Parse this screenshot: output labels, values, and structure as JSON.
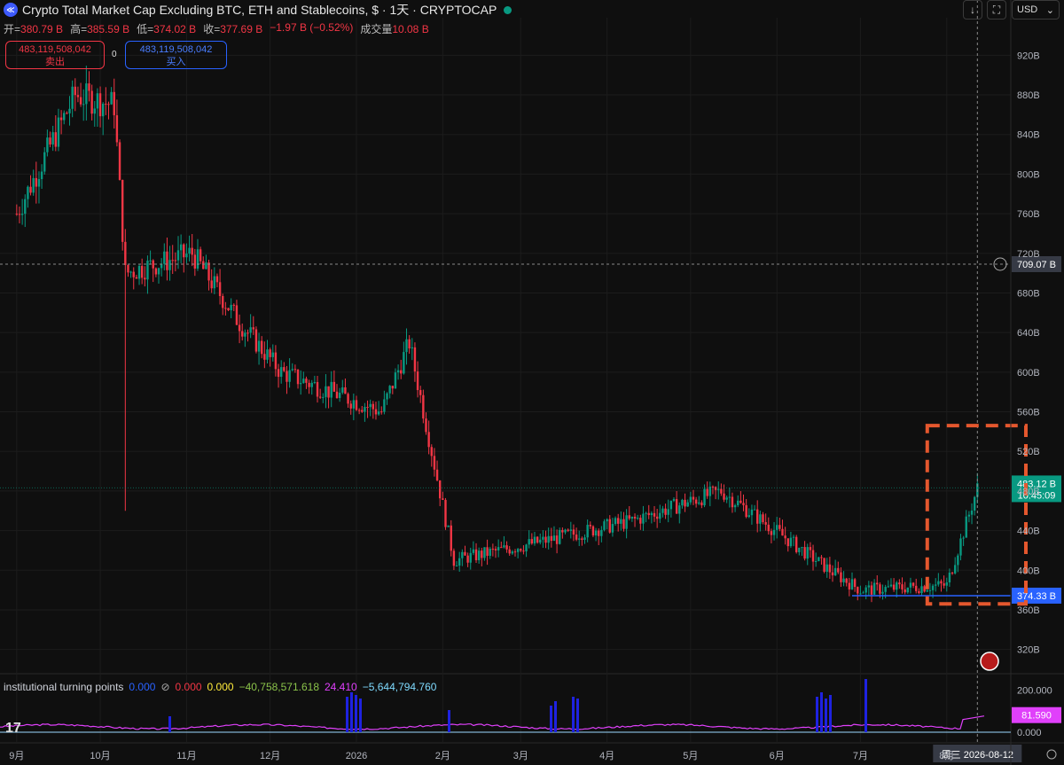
{
  "header": {
    "title": "Crypto Total Market Cap Excluding BTC, ETH and Stablecoins, $ · 1天 · CRYPTOCAP",
    "logo_glyph": "≪"
  },
  "ohlc": {
    "open_label": "开=",
    "open": "380.79 B",
    "high_label": "高=",
    "high": "385.59 B",
    "low_label": "低=",
    "low": "374.02 B",
    "close_label": "收=",
    "close": "377.69 B",
    "change": "−1.97 B (−0.52%)",
    "volume_label": "成交量",
    "volume": "10.08 B"
  },
  "trade": {
    "sell_price": "483,119,508,042",
    "sell_label": "卖出",
    "spread": "0",
    "buy_price": "483,119,508,042",
    "buy_label": "买入"
  },
  "toolbar": {
    "download_glyph": "↓",
    "fullscreen_glyph": "⛶",
    "currency": "USD",
    "currency_caret": "⌄"
  },
  "colors": {
    "up": "#089981",
    "down": "#f23645",
    "bg": "#0f0f0f",
    "grid": "#1c1c1c",
    "accent_blue": "#2962ff",
    "annotation": "#e4572e",
    "indicator_line": "#e040fb"
  },
  "indicator": {
    "name": "institutional turning points",
    "values": [
      "0.000",
      "0.000",
      "0.000",
      "−40,758,571.618",
      "24.410",
      "−5,644,794.760"
    ],
    "colors": [
      "#2962ff",
      "#f23645",
      "#ffeb3b",
      "#8bc34a",
      "#e040fb",
      "#7fdbff"
    ],
    "axis_ticks": [
      "200.000",
      "0.000"
    ],
    "current_label": "81.590"
  },
  "chart_data": {
    "type": "candlestick",
    "title": "Crypto Total Market Cap Excluding BTC, ETH and Stablecoins",
    "ylabel": "",
    "xlabel": "",
    "unit": "B",
    "ylim": [
      300,
      940
    ],
    "y_ticks": [
      320,
      360,
      400,
      440,
      480,
      520,
      560,
      600,
      640,
      680,
      720,
      760,
      800,
      840,
      880,
      920
    ],
    "x_tick_labels": [
      "9月",
      "10月",
      "11月",
      "12月",
      "2026",
      "2月",
      "3月",
      "4月",
      "5月",
      "6月",
      "7月",
      "8月"
    ],
    "crosshair": {
      "price_label": "709.07 B",
      "date_label": "周三 2026-08-12"
    },
    "last_price": {
      "label": "483.12 B",
      "countdown": "10:45:09"
    },
    "low_line_label": "374.33 B",
    "grid": true,
    "legend": "none",
    "key_points": [
      {
        "date": "2025-09-01",
        "close": 760
      },
      {
        "date": "2025-09-22",
        "close": 880
      },
      {
        "date": "2025-10-06",
        "close": 870
      },
      {
        "date": "2025-10-10",
        "low": 460,
        "close": 700
      },
      {
        "date": "2025-11-03",
        "close": 720
      },
      {
        "date": "2025-11-20",
        "close": 650
      },
      {
        "date": "2025-12-05",
        "close": 600
      },
      {
        "date": "2026-01-10",
        "close": 560
      },
      {
        "date": "2026-01-20",
        "close": 630
      },
      {
        "date": "2026-02-05",
        "close": 410
      },
      {
        "date": "2026-03-10",
        "close": 430
      },
      {
        "date": "2026-04-10",
        "close": 450
      },
      {
        "date": "2026-05-12",
        "close": 480
      },
      {
        "date": "2026-06-20",
        "close": 400
      },
      {
        "date": "2026-07-01",
        "close": 380
      },
      {
        "date": "2026-08-01",
        "close": 385
      },
      {
        "date": "2026-08-12",
        "close": 483.12
      }
    ]
  }
}
